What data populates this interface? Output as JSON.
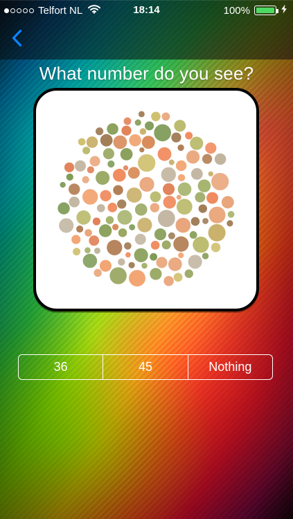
{
  "status_bar": {
    "carrier": "Telfort NL",
    "time": "18:14",
    "battery_percent": "100%",
    "signal_strength": 1,
    "signal_bars_total": 5,
    "battery_level": 1.0,
    "battery_color": "#4cd964"
  },
  "nav": {
    "back_icon": "chevron-left-icon",
    "back_color": "#0a84ff"
  },
  "quiz": {
    "prompt": "What number do you see?",
    "options": [
      {
        "label": "36"
      },
      {
        "label": "45"
      },
      {
        "label": "Nothing"
      }
    ]
  }
}
